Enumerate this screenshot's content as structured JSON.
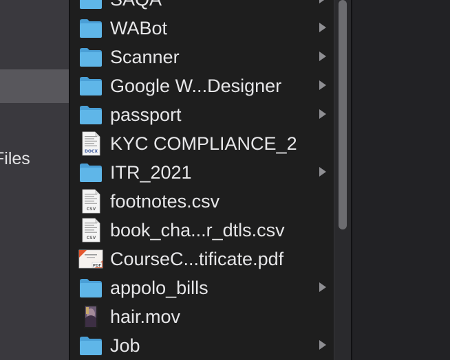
{
  "sidebar": {
    "partial_label": "iles"
  },
  "column": {
    "items": [
      {
        "name": "SAQA",
        "kind": "folder",
        "has_children": true
      },
      {
        "name": "WABot",
        "kind": "folder",
        "has_children": true
      },
      {
        "name": "Scanner",
        "kind": "folder",
        "has_children": true
      },
      {
        "name": "Google W...Designer",
        "kind": "folder",
        "has_children": true
      },
      {
        "name": "passport",
        "kind": "folder",
        "has_children": true
      },
      {
        "name": "KYC COMPLIANCE_2",
        "kind": "docx",
        "has_children": false,
        "badge": "DOCX"
      },
      {
        "name": "ITR_2021",
        "kind": "folder",
        "has_children": true
      },
      {
        "name": "footnotes.csv",
        "kind": "csv",
        "has_children": false,
        "badge": "CSV"
      },
      {
        "name": "book_cha...r_dtls.csv",
        "kind": "csv",
        "has_children": false,
        "badge": "CSV"
      },
      {
        "name": "CourseC...tificate.pdf",
        "kind": "pdf",
        "has_children": false,
        "badge": "PDF"
      },
      {
        "name": "appolo_bills",
        "kind": "folder",
        "has_children": true
      },
      {
        "name": "hair.mov",
        "kind": "video",
        "has_children": false
      },
      {
        "name": "Job",
        "kind": "folder",
        "has_children": true
      }
    ]
  },
  "colors": {
    "folder": "#5fb6e8",
    "folder_tab": "#4a9fd6",
    "sidebar_bg": "#3a393e",
    "sidebar_selected": "#58575c",
    "column_bg": "#1e1e1e",
    "text": "#e6e6e8",
    "chevron": "#8f8f93"
  },
  "icons": {
    "folder": "folder-icon",
    "docx": "docx-file-icon",
    "csv": "csv-file-icon",
    "pdf": "pdf-file-icon",
    "video": "video-thumbnail-icon",
    "chevron": "chevron-right-icon"
  }
}
